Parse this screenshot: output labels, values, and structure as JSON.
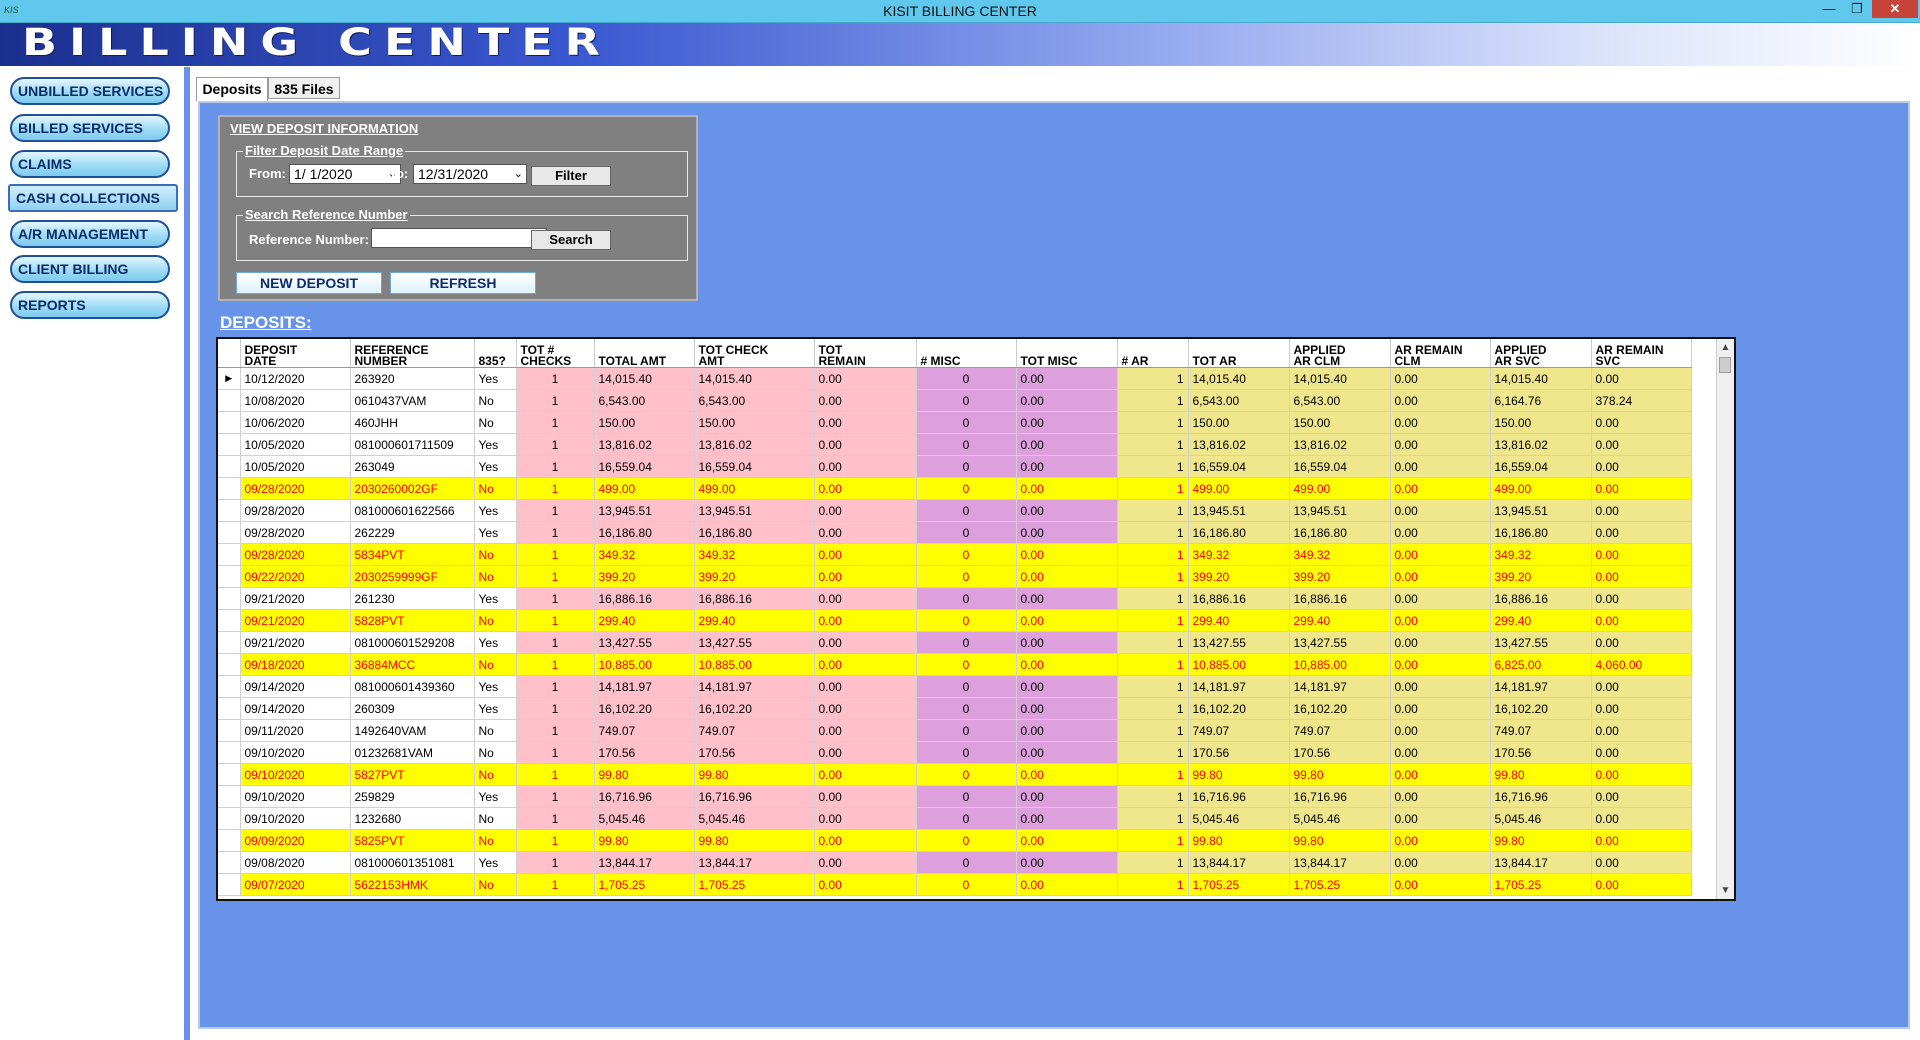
{
  "window": {
    "title": "KISIT BILLING CENTER",
    "app_icon": "KIS",
    "minimize": "—",
    "restore": "❐",
    "close": "✕"
  },
  "banner": {
    "title": "BILLING CENTER"
  },
  "sidebar": {
    "items": [
      {
        "label": "UNBILLED SERVICES"
      },
      {
        "label": "BILLED SERVICES"
      },
      {
        "label": "CLAIMS"
      },
      {
        "label": "CASH COLLECTIONS"
      },
      {
        "label": "A/R MANAGEMENT"
      },
      {
        "label": "CLIENT BILLING"
      },
      {
        "label": "REPORTS"
      }
    ],
    "active_index": 3
  },
  "tabs": [
    {
      "label": "Deposits"
    },
    {
      "label": "835 Files"
    }
  ],
  "view_panel": {
    "title": "VIEW DEPOSIT INFORMATION",
    "filter_legend": "Filter Deposit Date Range",
    "from_label": "From:",
    "from_value": "1/ 1/2020",
    "to_label": "To:",
    "to_value": "12/31/2020",
    "filter_button": "Filter",
    "search_legend": "Search Reference Number",
    "ref_label": "Reference Number:",
    "ref_value": "",
    "search_button": "Search",
    "new_deposit_button": "NEW DEPOSIT",
    "refresh_button": "REFRESH"
  },
  "deposits_heading": "DEPOSITS:",
  "table": {
    "columns": [
      {
        "l1": "DEPOSIT",
        "l2": "DATE"
      },
      {
        "l1": "REFERENCE",
        "l2": "NUMBER"
      },
      {
        "l1": "",
        "l2": "835?"
      },
      {
        "l1": "TOT #",
        "l2": "CHECKS"
      },
      {
        "l1": "",
        "l2": "TOTAL AMT"
      },
      {
        "l1": "TOT CHECK",
        "l2": "AMT"
      },
      {
        "l1": "TOT",
        "l2": "REMAIN"
      },
      {
        "l1": "",
        "l2": "# MISC"
      },
      {
        "l1": "",
        "l2": "TOT MISC"
      },
      {
        "l1": "",
        "l2": "# AR"
      },
      {
        "l1": "",
        "l2": "TOT AR"
      },
      {
        "l1": "APPLIED",
        "l2": "AR CLM"
      },
      {
        "l1": "AR REMAIN",
        "l2": "CLM"
      },
      {
        "l1": "APPLIED",
        "l2": "AR SVC"
      },
      {
        "l1": "AR REMAIN",
        "l2": "SVC"
      }
    ],
    "current_row_marker": "▶",
    "rows": [
      {
        "hl": false,
        "cells": [
          "10/12/2020",
          "263920",
          "Yes",
          "1",
          "14,015.40",
          "14,015.40",
          "0.00",
          "0",
          "0.00",
          "1",
          "14,015.40",
          "14,015.40",
          "0.00",
          "14,015.40",
          "0.00"
        ]
      },
      {
        "hl": false,
        "cells": [
          "10/08/2020",
          "0610437VAM",
          "No",
          "1",
          "6,543.00",
          "6,543.00",
          "0.00",
          "0",
          "0.00",
          "1",
          "6,543.00",
          "6,543.00",
          "0.00",
          "6,164.76",
          "378.24"
        ],
        "red_last": true
      },
      {
        "hl": false,
        "cells": [
          "10/06/2020",
          "460JHH",
          "No",
          "1",
          "150.00",
          "150.00",
          "0.00",
          "0",
          "0.00",
          "1",
          "150.00",
          "150.00",
          "0.00",
          "150.00",
          "0.00"
        ]
      },
      {
        "hl": false,
        "cells": [
          "10/05/2020",
          "081000601711509",
          "Yes",
          "1",
          "13,816.02",
          "13,816.02",
          "0.00",
          "0",
          "0.00",
          "1",
          "13,816.02",
          "13,816.02",
          "0.00",
          "13,816.02",
          "0.00"
        ]
      },
      {
        "hl": false,
        "cells": [
          "10/05/2020",
          "263049",
          "Yes",
          "1",
          "16,559.04",
          "16,559.04",
          "0.00",
          "0",
          "0.00",
          "1",
          "16,559.04",
          "16,559.04",
          "0.00",
          "16,559.04",
          "0.00"
        ]
      },
      {
        "hl": true,
        "cells": [
          "09/28/2020",
          "2030260002GF",
          "No",
          "1",
          "499.00",
          "499.00",
          "0.00",
          "0",
          "0.00",
          "1",
          "499.00",
          "499.00",
          "0.00",
          "499.00",
          "0.00"
        ]
      },
      {
        "hl": false,
        "cells": [
          "09/28/2020",
          "081000601622566",
          "Yes",
          "1",
          "13,945.51",
          "13,945.51",
          "0.00",
          "0",
          "0.00",
          "1",
          "13,945.51",
          "13,945.51",
          "0.00",
          "13,945.51",
          "0.00"
        ]
      },
      {
        "hl": false,
        "cells": [
          "09/28/2020",
          "262229",
          "Yes",
          "1",
          "16,186.80",
          "16,186.80",
          "0.00",
          "0",
          "0.00",
          "1",
          "16,186.80",
          "16,186.80",
          "0.00",
          "16,186.80",
          "0.00"
        ]
      },
      {
        "hl": true,
        "cells": [
          "09/28/2020",
          "5834PVT",
          "No",
          "1",
          "349.32",
          "349.32",
          "0.00",
          "0",
          "0.00",
          "1",
          "349.32",
          "349.32",
          "0.00",
          "349.32",
          "0.00"
        ]
      },
      {
        "hl": true,
        "cells": [
          "09/22/2020",
          "2030259999GF",
          "No",
          "1",
          "399.20",
          "399.20",
          "0.00",
          "0",
          "0.00",
          "1",
          "399.20",
          "399.20",
          "0.00",
          "399.20",
          "0.00"
        ]
      },
      {
        "hl": false,
        "cells": [
          "09/21/2020",
          "261230",
          "Yes",
          "1",
          "16,886.16",
          "16,886.16",
          "0.00",
          "0",
          "0.00",
          "1",
          "16,886.16",
          "16,886.16",
          "0.00",
          "16,886.16",
          "0.00"
        ]
      },
      {
        "hl": true,
        "cells": [
          "09/21/2020",
          "5828PVT",
          "No",
          "1",
          "299.40",
          "299.40",
          "0.00",
          "0",
          "0.00",
          "1",
          "299.40",
          "299.40",
          "0.00",
          "299.40",
          "0.00"
        ]
      },
      {
        "hl": false,
        "cells": [
          "09/21/2020",
          "081000601529208",
          "Yes",
          "1",
          "13,427.55",
          "13,427.55",
          "0.00",
          "0",
          "0.00",
          "1",
          "13,427.55",
          "13,427.55",
          "0.00",
          "13,427.55",
          "0.00"
        ]
      },
      {
        "hl": true,
        "cells": [
          "09/18/2020",
          "36884MCC",
          "No",
          "1",
          "10,885.00",
          "10,885.00",
          "0.00",
          "0",
          "0.00",
          "1",
          "10,885.00",
          "10,885.00",
          "0.00",
          "6,825.00",
          "4,060.00"
        ]
      },
      {
        "hl": false,
        "cells": [
          "09/14/2020",
          "081000601439360",
          "Yes",
          "1",
          "14,181.97",
          "14,181.97",
          "0.00",
          "0",
          "0.00",
          "1",
          "14,181.97",
          "14,181.97",
          "0.00",
          "14,181.97",
          "0.00"
        ]
      },
      {
        "hl": false,
        "cells": [
          "09/14/2020",
          "260309",
          "Yes",
          "1",
          "16,102.20",
          "16,102.20",
          "0.00",
          "0",
          "0.00",
          "1",
          "16,102.20",
          "16,102.20",
          "0.00",
          "16,102.20",
          "0.00"
        ]
      },
      {
        "hl": false,
        "cells": [
          "09/11/2020",
          "1492640VAM",
          "No",
          "1",
          "749.07",
          "749.07",
          "0.00",
          "0",
          "0.00",
          "1",
          "749.07",
          "749.07",
          "0.00",
          "749.07",
          "0.00"
        ]
      },
      {
        "hl": false,
        "cells": [
          "09/10/2020",
          "01232681VAM",
          "No",
          "1",
          "170.56",
          "170.56",
          "0.00",
          "0",
          "0.00",
          "1",
          "170.56",
          "170.56",
          "0.00",
          "170.56",
          "0.00"
        ]
      },
      {
        "hl": true,
        "cells": [
          "09/10/2020",
          "5827PVT",
          "No",
          "1",
          "99.80",
          "99.80",
          "0.00",
          "0",
          "0.00",
          "1",
          "99.80",
          "99.80",
          "0.00",
          "99.80",
          "0.00"
        ]
      },
      {
        "hl": false,
        "cells": [
          "09/10/2020",
          "259829",
          "Yes",
          "1",
          "16,716.96",
          "16,716.96",
          "0.00",
          "0",
          "0.00",
          "1",
          "16,716.96",
          "16,716.96",
          "0.00",
          "16,716.96",
          "0.00"
        ]
      },
      {
        "hl": false,
        "cells": [
          "09/10/2020",
          "1232680",
          "No",
          "1",
          "5,045.46",
          "5,045.46",
          "0.00",
          "0",
          "0.00",
          "1",
          "5,045.46",
          "5,045.46",
          "0.00",
          "5,045.46",
          "0.00"
        ]
      },
      {
        "hl": true,
        "cells": [
          "09/09/2020",
          "5825PVT",
          "No",
          "1",
          "99.80",
          "99.80",
          "0.00",
          "0",
          "0.00",
          "1",
          "99.80",
          "99.80",
          "0.00",
          "99.80",
          "0.00"
        ]
      },
      {
        "hl": false,
        "cells": [
          "09/08/2020",
          "081000601351081",
          "Yes",
          "1",
          "13,844.17",
          "13,844.17",
          "0.00",
          "0",
          "0.00",
          "1",
          "13,844.17",
          "13,844.17",
          "0.00",
          "13,844.17",
          "0.00"
        ]
      },
      {
        "hl": true,
        "cells": [
          "09/07/2020",
          "5622153HMK",
          "No",
          "1",
          "1,705.25",
          "1,705.25",
          "0.00",
          "0",
          "0.00",
          "1",
          "1,705.25",
          "1,705.25",
          "0.00",
          "1,705.25",
          "0.00"
        ]
      }
    ]
  },
  "scrollbar": {
    "up": "▲",
    "down": "▼"
  },
  "colors": {
    "panel_bg": "#6794e8",
    "highlight_row": "#ffff00",
    "highlight_text": "#ff0000",
    "pink_col": "#ffc0cb",
    "violet_col": "#dda0dd",
    "khaki_col": "#f0e68c"
  }
}
